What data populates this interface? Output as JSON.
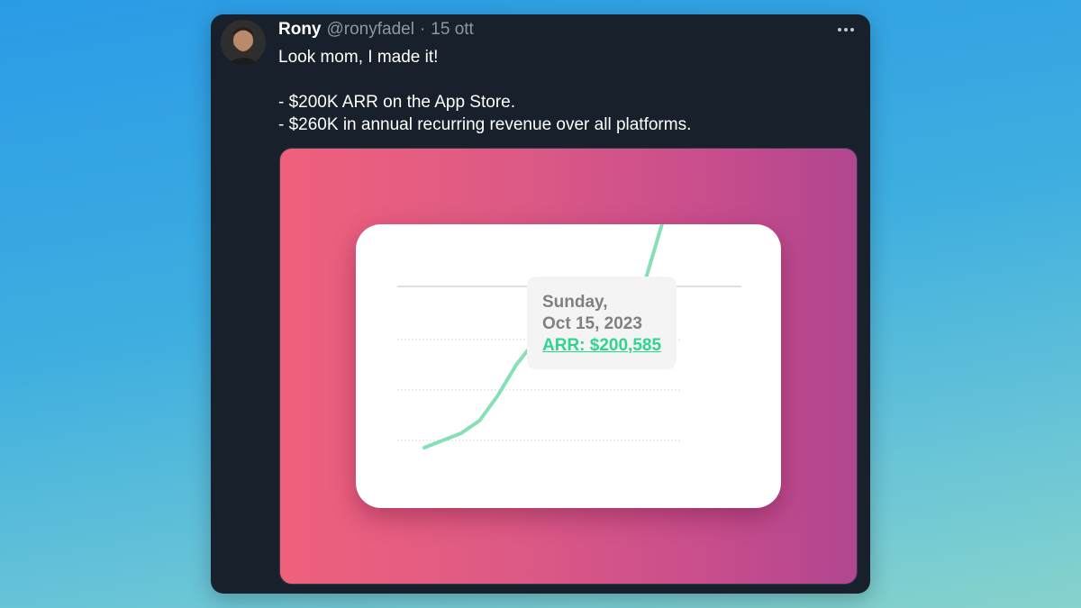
{
  "tweet": {
    "author_name": "Rony",
    "handle": "@ronyfadel",
    "separator": "·",
    "date": "15 ott",
    "more_icon": "ellipsis-icon",
    "text_lines": [
      "Look mom, I made it!",
      "- $200K ARR on the App Store.",
      "- $260K in annual recurring revenue over all platforms."
    ]
  },
  "colors": {
    "tweet_background": "#17202b",
    "media_gradient_start": "#f0607c",
    "media_gradient_end": "#b1468f",
    "line_color": "#86e0b5",
    "point_color": "#1ec97a"
  },
  "tooltip": {
    "day": "Sunday,",
    "date": "Oct 15, 2023",
    "arr": "ARR: $200,585"
  },
  "chart_data": {
    "type": "line",
    "title": "",
    "xlabel": "",
    "ylabel": "",
    "grid": true,
    "y": [
      22,
      30,
      38,
      52,
      80,
      114,
      140,
      146,
      178,
      184,
      193,
      193,
      207,
      276,
      277
    ],
    "highlight": {
      "label": "Oct 15, 2023",
      "value": 200585
    }
  }
}
